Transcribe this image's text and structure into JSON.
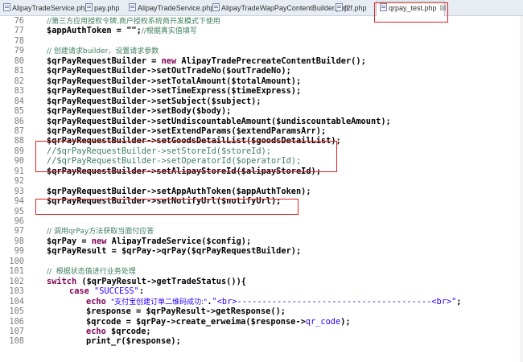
{
  "tabs": [
    {
      "label": "AlipayTradeService.php",
      "active": false
    },
    {
      "label": "pay.php",
      "active": false
    },
    {
      "label": "AlipayTradeService.php",
      "active": false
    },
    {
      "label": "AlipayTradeWapPayContentBuilder.php",
      "active": false
    },
    {
      "label": "f2f.php",
      "active": false
    },
    {
      "label": "qrpay_test.php",
      "active": true,
      "close_glyph": "☒"
    }
  ],
  "icons": {
    "file": "php-file-icon",
    "close": "close-icon"
  },
  "colors": {
    "highlight_box": "#e02020",
    "comment": "#3f7f5f",
    "keyword": "#7f0055",
    "string": "#2a00ff"
  },
  "lines": [
    {
      "n": "76",
      "indent": 1,
      "parts": [
        {
          "t": "//第三方应用授权令牌,商户授权系统商开发模式下使用",
          "c": "cmt"
        }
      ]
    },
    {
      "n": "77",
      "indent": 1,
      "parts": [
        {
          "t": "$appAuthToken = \"\";",
          "c": "var"
        },
        {
          "t": "//根据真实值填写",
          "c": "cmt"
        }
      ]
    },
    {
      "n": "78",
      "indent": 1,
      "parts": []
    },
    {
      "n": "79",
      "indent": 1,
      "parts": [
        {
          "t": "// 创建请求builder，设置请求参数",
          "c": "cmt"
        }
      ]
    },
    {
      "n": "80",
      "indent": 1,
      "parts": [
        {
          "t": "$qrPayRequestBuilder = ",
          "c": "var"
        },
        {
          "t": "new",
          "c": "kw"
        },
        {
          "t": " AlipayTradePrecreateContentBuilder();",
          "c": "var"
        }
      ]
    },
    {
      "n": "81",
      "indent": 1,
      "parts": [
        {
          "t": "$qrPayRequestBuilder->setOutTradeNo($outTradeNo);",
          "c": "var"
        }
      ]
    },
    {
      "n": "82",
      "indent": 1,
      "parts": [
        {
          "t": "$qrPayRequestBuilder->setTotalAmount($totalAmount);",
          "c": "var"
        }
      ]
    },
    {
      "n": "83",
      "indent": 1,
      "parts": [
        {
          "t": "$qrPayRequestBuilder->setTimeExpress($timeExpress);",
          "c": "var"
        }
      ]
    },
    {
      "n": "84",
      "indent": 1,
      "parts": [
        {
          "t": "$qrPayRequestBuilder->setSubject($subject);",
          "c": "var"
        }
      ]
    },
    {
      "n": "85",
      "indent": 1,
      "parts": [
        {
          "t": "$qrPayRequestBuilder->setBody($body);",
          "c": "var"
        }
      ]
    },
    {
      "n": "86",
      "indent": 1,
      "parts": [
        {
          "t": "$qrPayRequestBuilder->setUndiscountableAmount($undiscountableAmount);",
          "c": "var"
        }
      ]
    },
    {
      "n": "87",
      "indent": 1,
      "parts": [
        {
          "t": "$qrPayRequestBuilder->setExtendParams($extendParamsArr);",
          "c": "var"
        }
      ]
    },
    {
      "n": "88",
      "indent": 1,
      "parts": [
        {
          "t": "$qrPayRequestBuilder->setGoodsDetailList($goodsDetailList);",
          "c": "var"
        }
      ]
    },
    {
      "n": "89",
      "indent": 1,
      "parts": [
        {
          "t": "//$qrPayRequestBuilder->setStoreId($storeId);",
          "c": "cmtcode"
        }
      ]
    },
    {
      "n": "90",
      "indent": 1,
      "parts": [
        {
          "t": "//$qrPayRequestBuilder->setOperatorId($operatorId);",
          "c": "cmtcode"
        }
      ]
    },
    {
      "n": "91",
      "indent": 1,
      "parts": [
        {
          "t": "$qrPayRequestBuilder->setAlipayStoreId($alipayStoreId);",
          "c": "var"
        }
      ]
    },
    {
      "n": "92",
      "indent": 1,
      "parts": []
    },
    {
      "n": "93",
      "indent": 1,
      "parts": [
        {
          "t": "$qrPayRequestBuilder->setAppAuthToken($appAuthToken);",
          "c": "var"
        }
      ]
    },
    {
      "n": "94",
      "indent": 1,
      "parts": [
        {
          "t": "$qrPayRequestBuilder->setNotifyUrl($notifyUrl);",
          "c": "var"
        }
      ]
    },
    {
      "n": "95",
      "indent": 1,
      "parts": []
    },
    {
      "n": "96",
      "indent": 1,
      "parts": []
    },
    {
      "n": "97",
      "indent": 1,
      "parts": [
        {
          "t": "// 调用qrPay方法获取当面付应答",
          "c": "cmt"
        }
      ]
    },
    {
      "n": "98",
      "indent": 1,
      "parts": [
        {
          "t": "$qrPay = ",
          "c": "var"
        },
        {
          "t": "new",
          "c": "kw"
        },
        {
          "t": " AlipayTradeService($config);",
          "c": "var"
        }
      ]
    },
    {
      "n": "99",
      "indent": 1,
      "parts": [
        {
          "t": "$qrPayResult = $qrPay->qrPay($qrPayRequestBuilder);",
          "c": "var"
        }
      ]
    },
    {
      "n": "100",
      "indent": 1,
      "parts": []
    },
    {
      "n": "101",
      "indent": 1,
      "parts": [
        {
          "t": "//  根据状态值进行业务处理",
          "c": "cmt"
        }
      ]
    },
    {
      "n": "102",
      "indent": 1,
      "parts": [
        {
          "t": "switch",
          "c": "kw"
        },
        {
          "t": " ($qrPayResult->getTradeStatus()){",
          "c": "var"
        }
      ]
    },
    {
      "n": "103",
      "indent": 2,
      "parts": [
        {
          "t": "case",
          "c": "kw"
        },
        {
          "t": " ",
          "c": "var"
        },
        {
          "t": "\"SUCCESS\"",
          "c": "str"
        },
        {
          "t": ":",
          "c": "var"
        }
      ]
    },
    {
      "n": "104",
      "indent": 3,
      "parts": [
        {
          "t": "echo",
          "c": "kw"
        },
        {
          "t": " ",
          "c": "var"
        },
        {
          "t": "\"支付宝创建订单二维码成功:\"",
          "c": "str"
        },
        {
          "t": ".",
          "c": "var"
        },
        {
          "t": "\"<br>---------------------------------------<br>\"",
          "c": "str"
        },
        {
          "t": ";",
          "c": "var"
        }
      ]
    },
    {
      "n": "105",
      "indent": 3,
      "parts": [
        {
          "t": "$response = $qrPayResult->getResponse();",
          "c": "var"
        }
      ]
    },
    {
      "n": "106",
      "indent": 3,
      "parts": [
        {
          "t": "$qrcode = $qrPay->create_erweima($response->",
          "c": "var"
        },
        {
          "t": "qr_code",
          "c": "str"
        },
        {
          "t": ");",
          "c": "var"
        }
      ]
    },
    {
      "n": "107",
      "indent": 3,
      "parts": [
        {
          "t": "echo",
          "c": "kw"
        },
        {
          "t": " $qrcode;",
          "c": "var"
        }
      ]
    },
    {
      "n": "108",
      "indent": 3,
      "parts": [
        {
          "t": "print_r($response);",
          "c": "var"
        }
      ]
    }
  ]
}
